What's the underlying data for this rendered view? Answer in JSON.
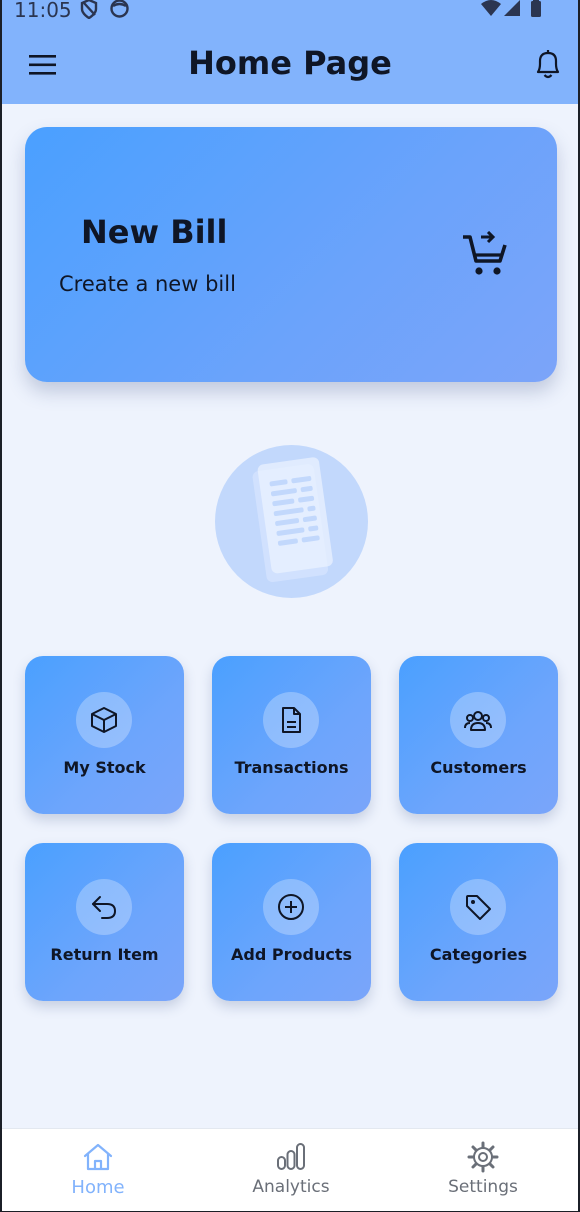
{
  "status": {
    "time": "11:05"
  },
  "appbar": {
    "title": "Home Page"
  },
  "new_bill": {
    "title": "New Bill",
    "subtitle": "Create a new bill"
  },
  "tiles": [
    {
      "label": "My Stock",
      "icon": "box-icon"
    },
    {
      "label": "Transactions",
      "icon": "document-icon"
    },
    {
      "label": "Customers",
      "icon": "users-icon"
    },
    {
      "label": "Return Item",
      "icon": "return-arrow-icon"
    },
    {
      "label": "Add Products",
      "icon": "plus-circle-icon"
    },
    {
      "label": "Categories",
      "icon": "tag-icon"
    }
  ],
  "bottom_nav": [
    {
      "label": "Home",
      "icon": "home-icon",
      "active": true
    },
    {
      "label": "Analytics",
      "icon": "bar-chart-icon",
      "active": false
    },
    {
      "label": "Settings",
      "icon": "gear-icon",
      "active": false
    }
  ],
  "colors": {
    "accent": "#82b3fc",
    "tile_start": "#4aa0ff",
    "tile_end": "#7aa5fa",
    "background": "#eef3fd"
  }
}
